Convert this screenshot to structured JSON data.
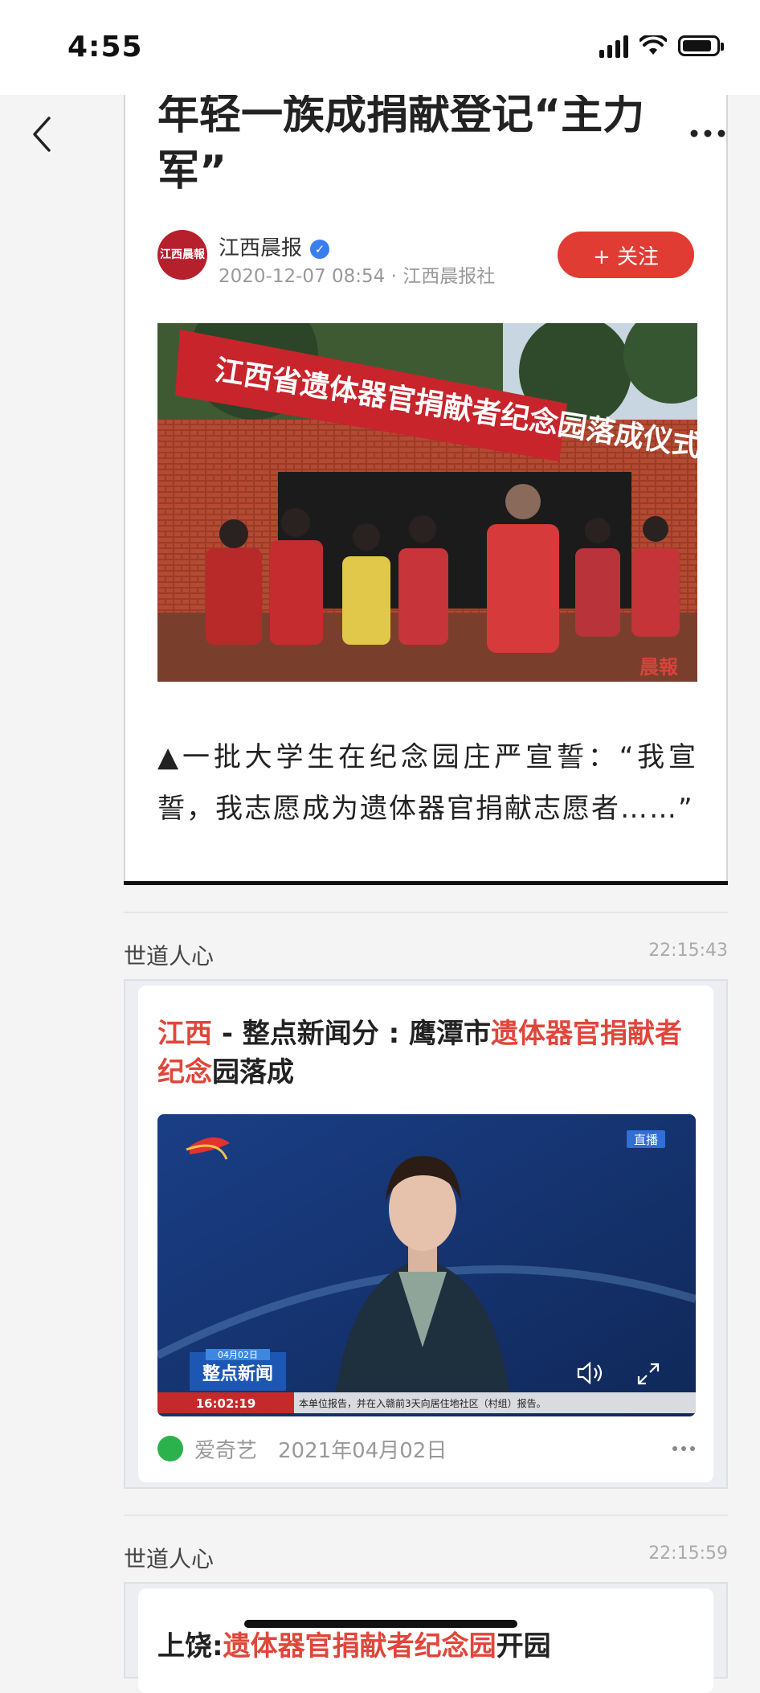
{
  "status_bar": {
    "time": "4:55"
  },
  "article": {
    "title": "年轻一族成捐献登记“主力军”",
    "author": {
      "name": "江西晨报",
      "logo_text": "江西晨報",
      "date": "2020-12-07 08:54",
      "publisher": "江西晨报社"
    },
    "follow_label": "+ 关注",
    "photo_banner": "江西省遗体器官捐献者纪念园落成仪式",
    "photo_watermark": "晨報",
    "caption": "▲一批大学生在纪念园庄严宣誓：“我宣誓，我志愿成为遗体器官捐献志愿者……”"
  },
  "feed": [
    {
      "label": "世道人心",
      "time": "22:15:43",
      "headline": {
        "part1": "江西",
        "part2": " - 整点新闻分 : 鹰潭市",
        "part3": "遗体器官捐献者纪念",
        "part4": "园落成"
      },
      "video": {
        "live_badge": "直播",
        "program_date": "04月02日",
        "program_name": "整点新闻",
        "clock": "16:02:19",
        "ticker": "本单位报告，并在入赣前3天向居住地社区（村组）报告。"
      },
      "source": {
        "name": "爱奇艺",
        "date": "2021年04月02日"
      }
    },
    {
      "label": "世道人心",
      "time": "22:15:59",
      "headline": {
        "part1": "上饶:",
        "part2": "遗体器官捐献者纪念园",
        "part3": "开园"
      }
    }
  ],
  "colors": {
    "accent_red": "#e03c33",
    "highlight_red": "#e0463a",
    "verified_blue": "#3a7df0"
  },
  "icons": [
    "signal-icon",
    "wifi-icon",
    "battery-icon",
    "back-arrow-icon",
    "more-icon",
    "verified-icon",
    "volume-icon",
    "fullscreen-icon"
  ]
}
